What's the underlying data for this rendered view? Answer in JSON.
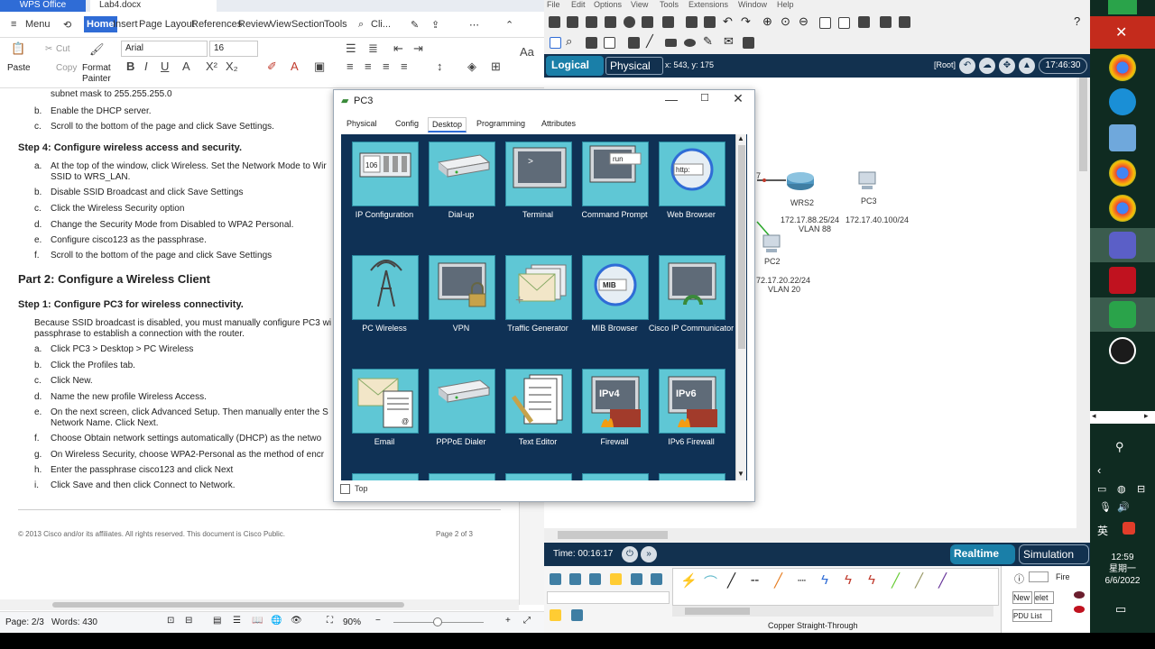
{
  "wps": {
    "brand": "WPS Office",
    "doc_tab": "Lab4.docx",
    "menu": {
      "menu_label": "Menu",
      "tabs": [
        "Home",
        "Insert",
        "Page Layout",
        "References",
        "Review",
        "View",
        "Section",
        "Tools"
      ],
      "search_placeholder": "Cli..."
    },
    "ribbon": {
      "cut": "Cut",
      "copy": "Copy",
      "paste": "Paste",
      "format_painter": "Format Painter",
      "font": "Arial",
      "size": "16"
    },
    "doc": {
      "line0": "subnet mask to 255.255.255.0",
      "b1_mark": "b.",
      "b1": "Enable the DHCP server.",
      "c1_mark": "c.",
      "c1": "Scroll to the bottom of the page and click Save Settings.",
      "step4": "Step 4:    Configure wireless access and security.",
      "a2_mark": "a.",
      "a2": "At the top of the window, click Wireless. Set the Network Mode to Wir",
      "a2b": "SSID to WRS_LAN.",
      "b2_mark": "b.",
      "b2": "Disable SSID Broadcast and click Save Settings",
      "c2_mark": "c.",
      "c2": "Click the Wireless Security option",
      "d2_mark": "d.",
      "d2": "Change the Security Mode from Disabled to WPA2 Personal.",
      "e2_mark": "e.",
      "e2": "Configure cisco123 as the passphrase.",
      "f2_mark": "f.",
      "f2": "Scroll to the bottom of the page and click Save Settings",
      "part2": "Part 2:   Configure a Wireless Client",
      "step1": "Step 1:    Configure PC3 for wireless connectivity.",
      "para1": "Because SSID broadcast is disabled, you must manually configure PC3 wi",
      "para2": "passphrase to establish a connection with the router.",
      "a3_mark": "a.",
      "a3": "Click PC3 > Desktop > PC Wireless",
      "b3_mark": "b.",
      "b3": "Click the Profiles tab.",
      "c3_mark": "c.",
      "c3": "Click New.",
      "d3_mark": "d.",
      "d3": "Name the new profile Wireless Access.",
      "e3_mark": "e.",
      "e3": "On the next screen, click Advanced Setup. Then manually enter the S",
      "e3b": "Network Name. Click Next.",
      "f3_mark": "f.",
      "f3": "Choose Obtain network settings automatically (DHCP) as the netwo",
      "g3_mark": "g.",
      "g3": "On Wireless Security, choose WPA2-Personal as the method of encr",
      "h3_mark": "h.",
      "h3": "Enter the passphrase cisco123 and click Next",
      "i3_mark": "i.",
      "i3": "Click Save and then click Connect to Network.",
      "footer": "© 2013 Cisco and/or its affiliates. All rights reserved. This document is Cisco Public.",
      "page_footer": "Page 2 of 3"
    },
    "status": {
      "page": "Page: 2/3",
      "words": "Words: 430",
      "zoom": "90%"
    }
  },
  "pt": {
    "menu": [
      "File",
      "Edit",
      "Options",
      "View",
      "Tools",
      "Extensions",
      "Window",
      "Help"
    ],
    "nav": {
      "logical": "Logical",
      "physical": "Physical",
      "coords": "x: 543, y: 175",
      "root": "[Root]",
      "clock": "17:46:30"
    },
    "canvas": {
      "wrs2": "WRS2",
      "pc3": "PC3",
      "pc2": "PC2",
      "wrs2_ip": "172.17.88.25/24",
      "wrs2_vlan": "VLAN 88",
      "pc3_ip": "172.17.40.100/24",
      "pc2_ip": "72.17.20.22/24",
      "pc2_vlan": "VLAN 20",
      "edge_num": "7"
    },
    "bottom": {
      "time": "Time: 00:16:17",
      "realtime": "Realtime",
      "simulation": "Simulation"
    },
    "tray": {
      "cable": "Copper Straight-Through",
      "fire": "Fire",
      "new": "New",
      "delete": "elet",
      "pdu": "PDU List"
    }
  },
  "pc3": {
    "title": "PC3",
    "tabs": [
      "Physical",
      "Config",
      "Desktop",
      "Programming",
      "Attributes"
    ],
    "apps": [
      {
        "label": "IP Configuration",
        "icon": "ip-config-icon"
      },
      {
        "label": "Dial-up",
        "icon": "dialup-modem-icon"
      },
      {
        "label": "Terminal",
        "icon": "terminal-icon"
      },
      {
        "label": "Command Prompt",
        "icon": "command-prompt-icon"
      },
      {
        "label": "Web Browser",
        "icon": "web-browser-icon"
      },
      {
        "label": "PC Wireless",
        "icon": "pc-wireless-icon"
      },
      {
        "label": "VPN",
        "icon": "vpn-lock-icon"
      },
      {
        "label": "Traffic Generator",
        "icon": "traffic-generator-icon"
      },
      {
        "label": "MIB Browser",
        "icon": "mib-browser-icon"
      },
      {
        "label": "Cisco IP Communicator",
        "icon": "ip-communicator-icon"
      },
      {
        "label": "Email",
        "icon": "email-icon"
      },
      {
        "label": "PPPoE Dialer",
        "icon": "pppoe-dialer-icon"
      },
      {
        "label": "Text Editor",
        "icon": "text-editor-icon"
      },
      {
        "label": "Firewall",
        "icon": "firewall-icon"
      },
      {
        "label": "IPv6 Firewall",
        "icon": "ipv6-firewall-icon"
      }
    ],
    "icon_text": {
      "ip": "106",
      "cmd": "run",
      "web": "http:",
      "mib": "MIB",
      "ipv4": "IPv4",
      "ipv6": "IPv6",
      "terminal": ">"
    },
    "top_label": "Top"
  },
  "sidebar": {
    "time": "12:59",
    "weekday": "星期一",
    "date": "6/6/2022",
    "ime": "英"
  }
}
